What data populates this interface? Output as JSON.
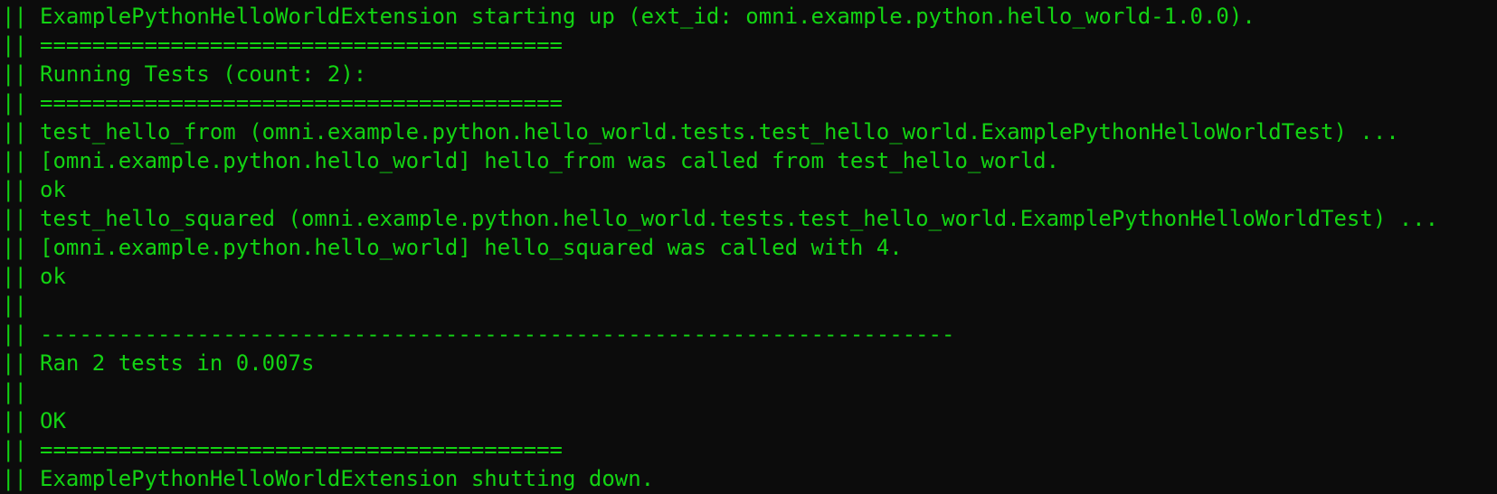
{
  "terminal": {
    "gutter": "||",
    "lines": [
      "ExamplePythonHelloWorldExtension starting up (ext_id: omni.example.python.hello_world-1.0.0).",
      "========================================",
      "Running Tests (count: 2):",
      "========================================",
      "test_hello_from (omni.example.python.hello_world.tests.test_hello_world.ExamplePythonHelloWorldTest) ...",
      "[omni.example.python.hello_world] hello_from was called from test_hello_world.",
      "ok",
      "test_hello_squared (omni.example.python.hello_world.tests.test_hello_world.ExamplePythonHelloWorldTest) ...",
      "[omni.example.python.hello_world] hello_squared was called with 4.",
      "ok",
      "",
      "----------------------------------------------------------------------",
      "Ran 2 tests in 0.007s",
      "",
      "OK",
      "========================================",
      "ExamplePythonHelloWorldExtension shutting down."
    ]
  },
  "colors": {
    "background": "#0c0c0c",
    "foreground": "#13d313"
  }
}
